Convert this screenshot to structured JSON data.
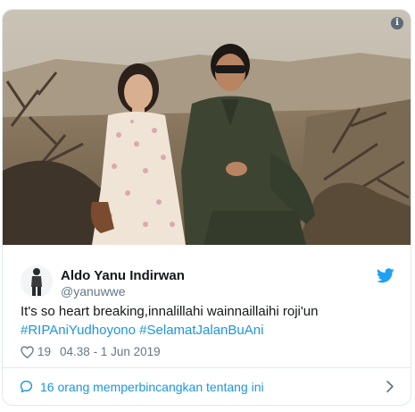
{
  "tweet": {
    "display_name": "Aldo Yanu Indirwan",
    "handle": "@yanuwwe",
    "text_prefix": "It's so heart breaking,innalillahi wainnaillaihi roji'un",
    "hashtags": [
      "#RIPAniYudhoyono",
      "#SelamatJalanBuAni"
    ],
    "like_count": "19",
    "timestamp": "04.38 - 1 Jun 2019",
    "footer_link": "16 orang memperbincangkan tentang ini"
  },
  "icons": {
    "info": "info-icon",
    "bird": "twitter-bird-icon",
    "heart": "heart-icon",
    "bubble": "chat-bubble-icon",
    "chevron": "chevron-right-icon"
  },
  "colors": {
    "link": "#1b95e0",
    "muted": "#657786",
    "text": "#14171a",
    "border": "#e1e8ed"
  }
}
